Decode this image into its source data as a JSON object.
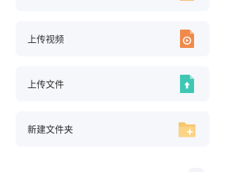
{
  "menu": {
    "items": [
      {
        "label": "上传视频",
        "icon": "video-file-icon",
        "color": "#f08a4b"
      },
      {
        "label": "上传文件",
        "icon": "upload-file-icon",
        "color": "#3fc7b4"
      },
      {
        "label": "新建文件夹",
        "icon": "folder-add-icon",
        "color": "#f7c56c"
      }
    ]
  },
  "colors": {
    "card_background": "#f5f7fb",
    "label_text": "#2b2b2b",
    "page_background": "#ffffff"
  }
}
